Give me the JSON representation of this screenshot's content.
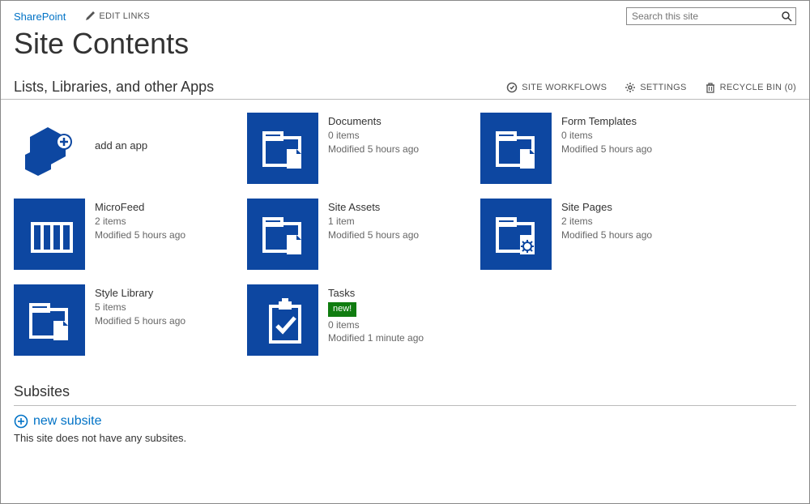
{
  "header": {
    "sharepoint": "SharePoint",
    "edit_links": "EDIT LINKS",
    "search_placeholder": "Search this site"
  },
  "page": {
    "title": "Site Contents"
  },
  "section_apps": {
    "title": "Lists, Libraries, and other Apps",
    "actions": {
      "workflows": "SITE WORKFLOWS",
      "settings": "SETTINGS",
      "recycle": "RECYCLE BIN (0)"
    }
  },
  "apps": {
    "add": {
      "label": "add an app"
    },
    "documents": {
      "name": "Documents",
      "items": "0 items",
      "modified": "Modified 5 hours ago"
    },
    "form_templates": {
      "name": "Form Templates",
      "items": "0 items",
      "modified": "Modified 5 hours ago"
    },
    "microfeed": {
      "name": "MicroFeed",
      "items": "2 items",
      "modified": "Modified 5 hours ago"
    },
    "site_assets": {
      "name": "Site Assets",
      "items": "1 item",
      "modified": "Modified 5 hours ago"
    },
    "site_pages": {
      "name": "Site Pages",
      "items": "2 items",
      "modified": "Modified 5 hours ago"
    },
    "style_library": {
      "name": "Style Library",
      "items": "5 items",
      "modified": "Modified 5 hours ago"
    },
    "tasks": {
      "name": "Tasks",
      "new_badge": "new!",
      "items": "0 items",
      "modified": "Modified 1 minute ago"
    }
  },
  "subsites": {
    "title": "Subsites",
    "new_label": "new subsite",
    "empty": "This site does not have any subsites."
  }
}
